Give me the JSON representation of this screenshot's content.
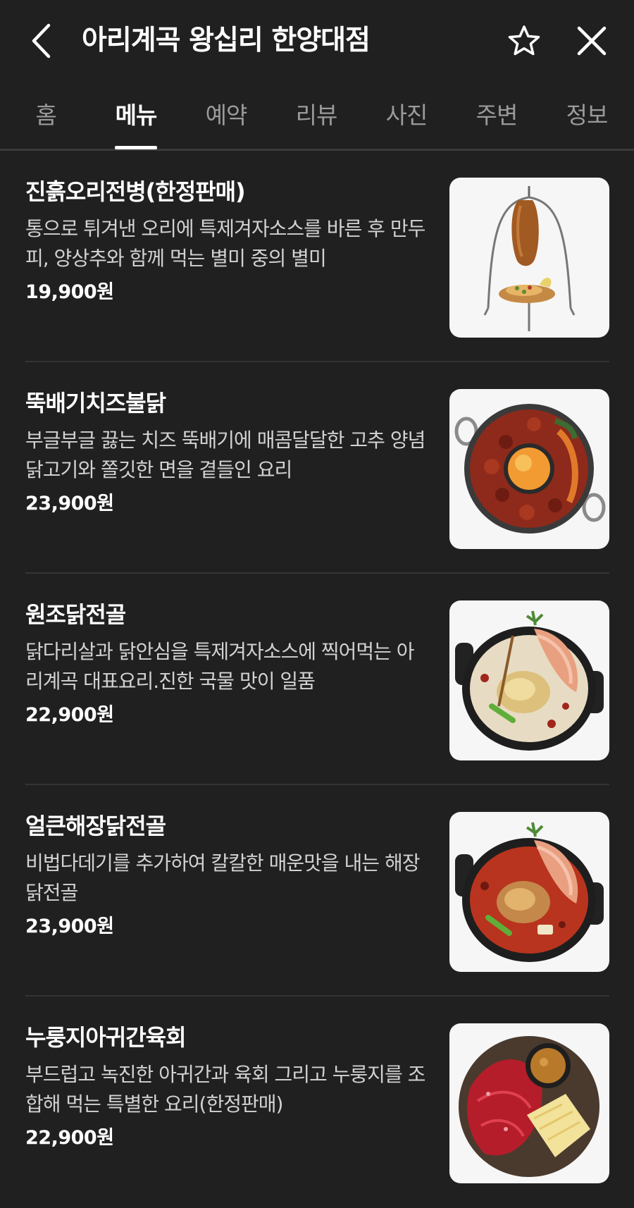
{
  "header": {
    "title": "아리계곡 왕십리 한양대점",
    "back_icon": "chevron-left-icon",
    "favorite_icon": "star-outline-icon",
    "close_icon": "close-icon"
  },
  "tabs": [
    {
      "label": "홈",
      "active": false
    },
    {
      "label": "메뉴",
      "active": true
    },
    {
      "label": "예약",
      "active": false
    },
    {
      "label": "리뷰",
      "active": false
    },
    {
      "label": "사진",
      "active": false
    },
    {
      "label": "주변",
      "active": false
    },
    {
      "label": "정보",
      "active": false
    }
  ],
  "menu": [
    {
      "name": "진흙오리전병(한정판매)",
      "description": "통으로 튀겨낸 오리에 특제겨자소스를 바른 후 만두피, 양상추와 함께 먹는 별미 중의 별미",
      "price": "19,900원"
    },
    {
      "name": "뚝배기치즈불닭",
      "description": "부글부글 끓는 치즈 뚝배기에 매콤달달한 고추 양념 닭고기와 쫄깃한 면을 곁들인 요리",
      "price": "23,900원"
    },
    {
      "name": "원조닭전골",
      "description": "닭다리살과 닭안심을 특제겨자소스에 찍어먹는 아리계곡 대표요리.진한 국물 맛이 일품",
      "price": "22,900원"
    },
    {
      "name": "얼큰해장닭전골",
      "description": "비법다데기를 추가하여 칼칼한 매운맛을 내는 해장 닭전골",
      "price": "23,900원"
    },
    {
      "name": "누룽지아귀간육회",
      "description": "부드럽고 녹진한 아귀간과 육회 그리고 누룽지를 조합해 먹는 특별한 요리(한정판매)",
      "price": "22,900원"
    }
  ],
  "colors": {
    "background": "#202020",
    "text": "#ffffff",
    "muted": "#9a9a9a",
    "divider": "#343434"
  }
}
